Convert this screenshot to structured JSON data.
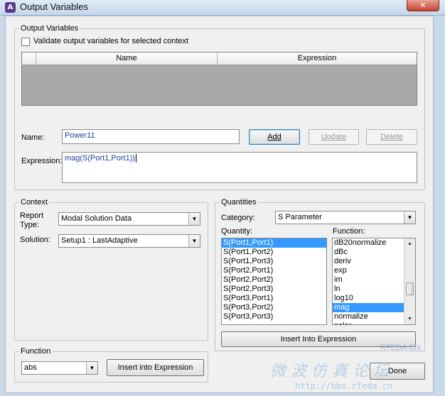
{
  "window": {
    "title": "Output Variables",
    "close_glyph": "✕"
  },
  "output_variables": {
    "group_label": "Output Variables",
    "validate_label": "Validate output variables for selected context",
    "columns": [
      "Name",
      "Expression"
    ],
    "name_label": "Name:",
    "name_value": "Power11",
    "expression_label": "Expression:",
    "expression_value": "mag(S(Port1,Port1))",
    "add_label": "Add",
    "update_label": "Update",
    "delete_label": "Delete"
  },
  "context": {
    "group_label": "Context",
    "report_type_label": "Report\nType:",
    "report_type_value": "Modal Solution Data",
    "solution_label": "Solution:",
    "solution_value": "Setup1 : LastAdaptive"
  },
  "quantities": {
    "group_label": "Quantities",
    "category_label": "Category:",
    "category_value": "S Parameter",
    "quantity_label": "Quantity:",
    "function_label": "Function:",
    "quantity_items": [
      "S(Port1,Port1)",
      "S(Port1,Port2)",
      "S(Port1,Port3)",
      "S(Port2,Port1)",
      "S(Port2,Port2)",
      "S(Port2,Port3)",
      "S(Port3,Port1)",
      "S(Port3,Port2)",
      "S(Port3,Port3)"
    ],
    "quantity_selected": "S(Port1,Port1)",
    "function_items": [
      "dB20normalize",
      "dBc",
      "deriv",
      "exp",
      "im",
      "ln",
      "log10",
      "mag",
      "normalize",
      "polar"
    ],
    "function_selected": "mag",
    "insert_label": "Insert Into Expression"
  },
  "function_group": {
    "group_label": "Function",
    "function_value": "abs",
    "insert_label": "Insert into Expression"
  },
  "done_label": "Done",
  "watermark": {
    "brand": "RFEDA.CN",
    "chinese": "微 波 仿 真 论 坛",
    "url": "http://bbs.rfeda.cn"
  }
}
